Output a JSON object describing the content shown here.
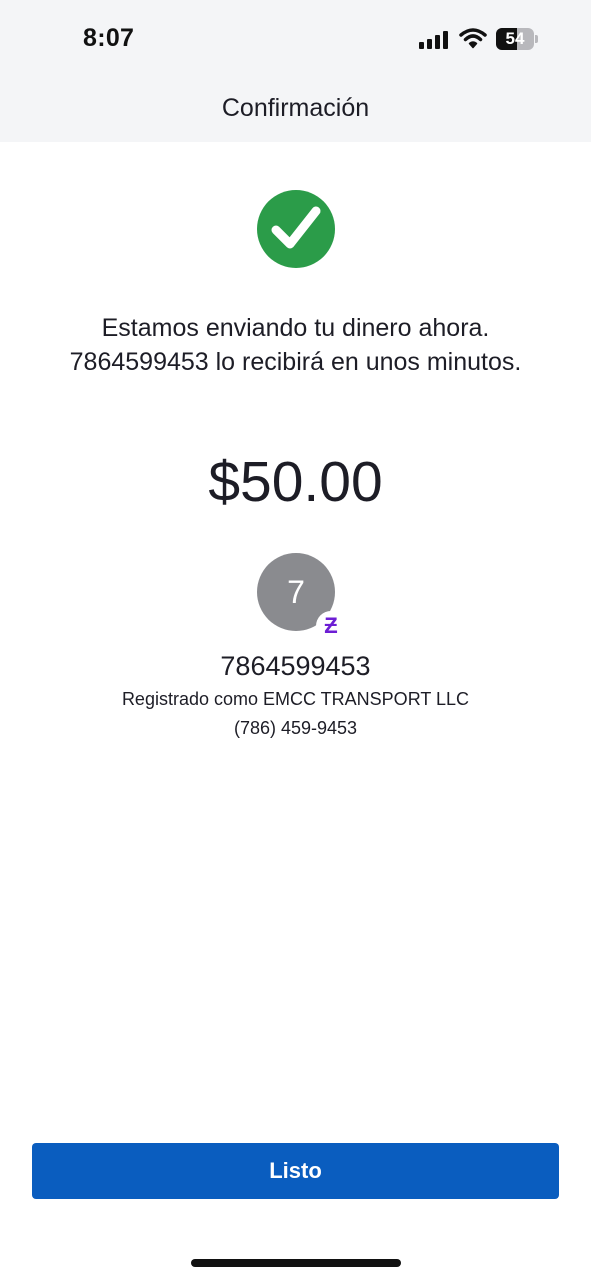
{
  "status_bar": {
    "time": "8:07",
    "battery_level": "54",
    "battery_fraction": 0.54
  },
  "nav": {
    "title": "Confirmación"
  },
  "confirmation": {
    "status_icon": "check-circle-icon",
    "status_color": "#2b9c49",
    "message": "Estamos enviando tu dinero ahora. 7864599453 lo recibirá en unos minutos.",
    "amount": "$50.00"
  },
  "recipient": {
    "avatar_initial": "7",
    "avatar_color": "#8a8b8f",
    "badge_icon": "zelle-icon",
    "badge_glyph": "Ƶ",
    "badge_color": "#6d1ed4",
    "identifier": "7864599453",
    "registered_as": "Registrado como EMCC TRANSPORT LLC",
    "phone_formatted": "(786) 459-9453"
  },
  "actions": {
    "done_label": "Listo",
    "done_color": "#0a5dbf"
  }
}
